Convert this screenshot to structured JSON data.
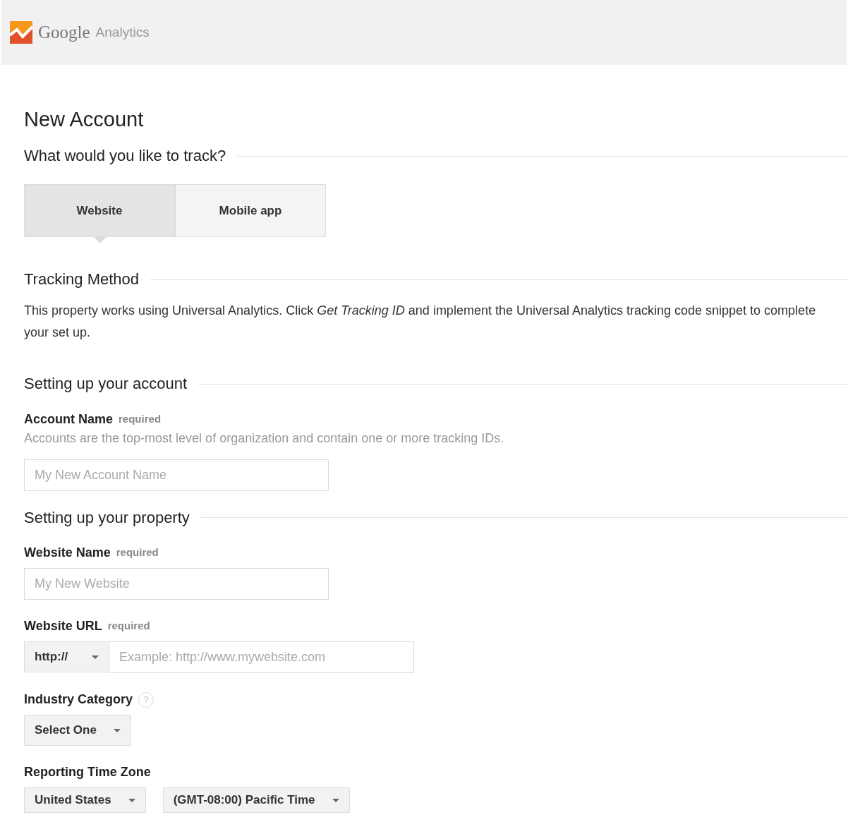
{
  "header": {
    "brand": "Google",
    "product": "Analytics"
  },
  "page_title": "New Account",
  "sections": [
    {
      "title": "What would you like to track?",
      "kind": "tabs",
      "tabs": [
        {
          "label": "Website",
          "selected": true
        },
        {
          "label": "Mobile app",
          "selected": false
        }
      ]
    },
    {
      "title": "Tracking Method",
      "kind": "paragraph",
      "text": "This property works using Universal Analytics. Click *Get Tracking ID* and implement the Universal Analytics tracking code snippet to complete your set up."
    },
    {
      "title": "Setting up your account",
      "kind": "fields",
      "fields": [
        {
          "kind": "text",
          "label": "Account Name",
          "required": "required",
          "description": "Accounts are the top-most level of organization and contain one or more tracking IDs.",
          "placeholder": "My New Account Name"
        }
      ]
    },
    {
      "title": "Setting up your property",
      "kind": "fields",
      "fields": [
        {
          "kind": "text",
          "label": "Website Name",
          "required": "required",
          "placeholder": "My New Website"
        },
        {
          "kind": "url",
          "label": "Website URL",
          "required": "required",
          "protocol": "http://",
          "placeholder": "Example: http://www.mywebsite.com"
        },
        {
          "kind": "selects",
          "label": "Industry Category",
          "help": "?",
          "selects": [
            "Select One"
          ]
        },
        {
          "kind": "selects",
          "label": "Reporting Time Zone",
          "selects": [
            "United States",
            "(GMT-08:00) Pacific Time"
          ]
        }
      ]
    }
  ]
}
